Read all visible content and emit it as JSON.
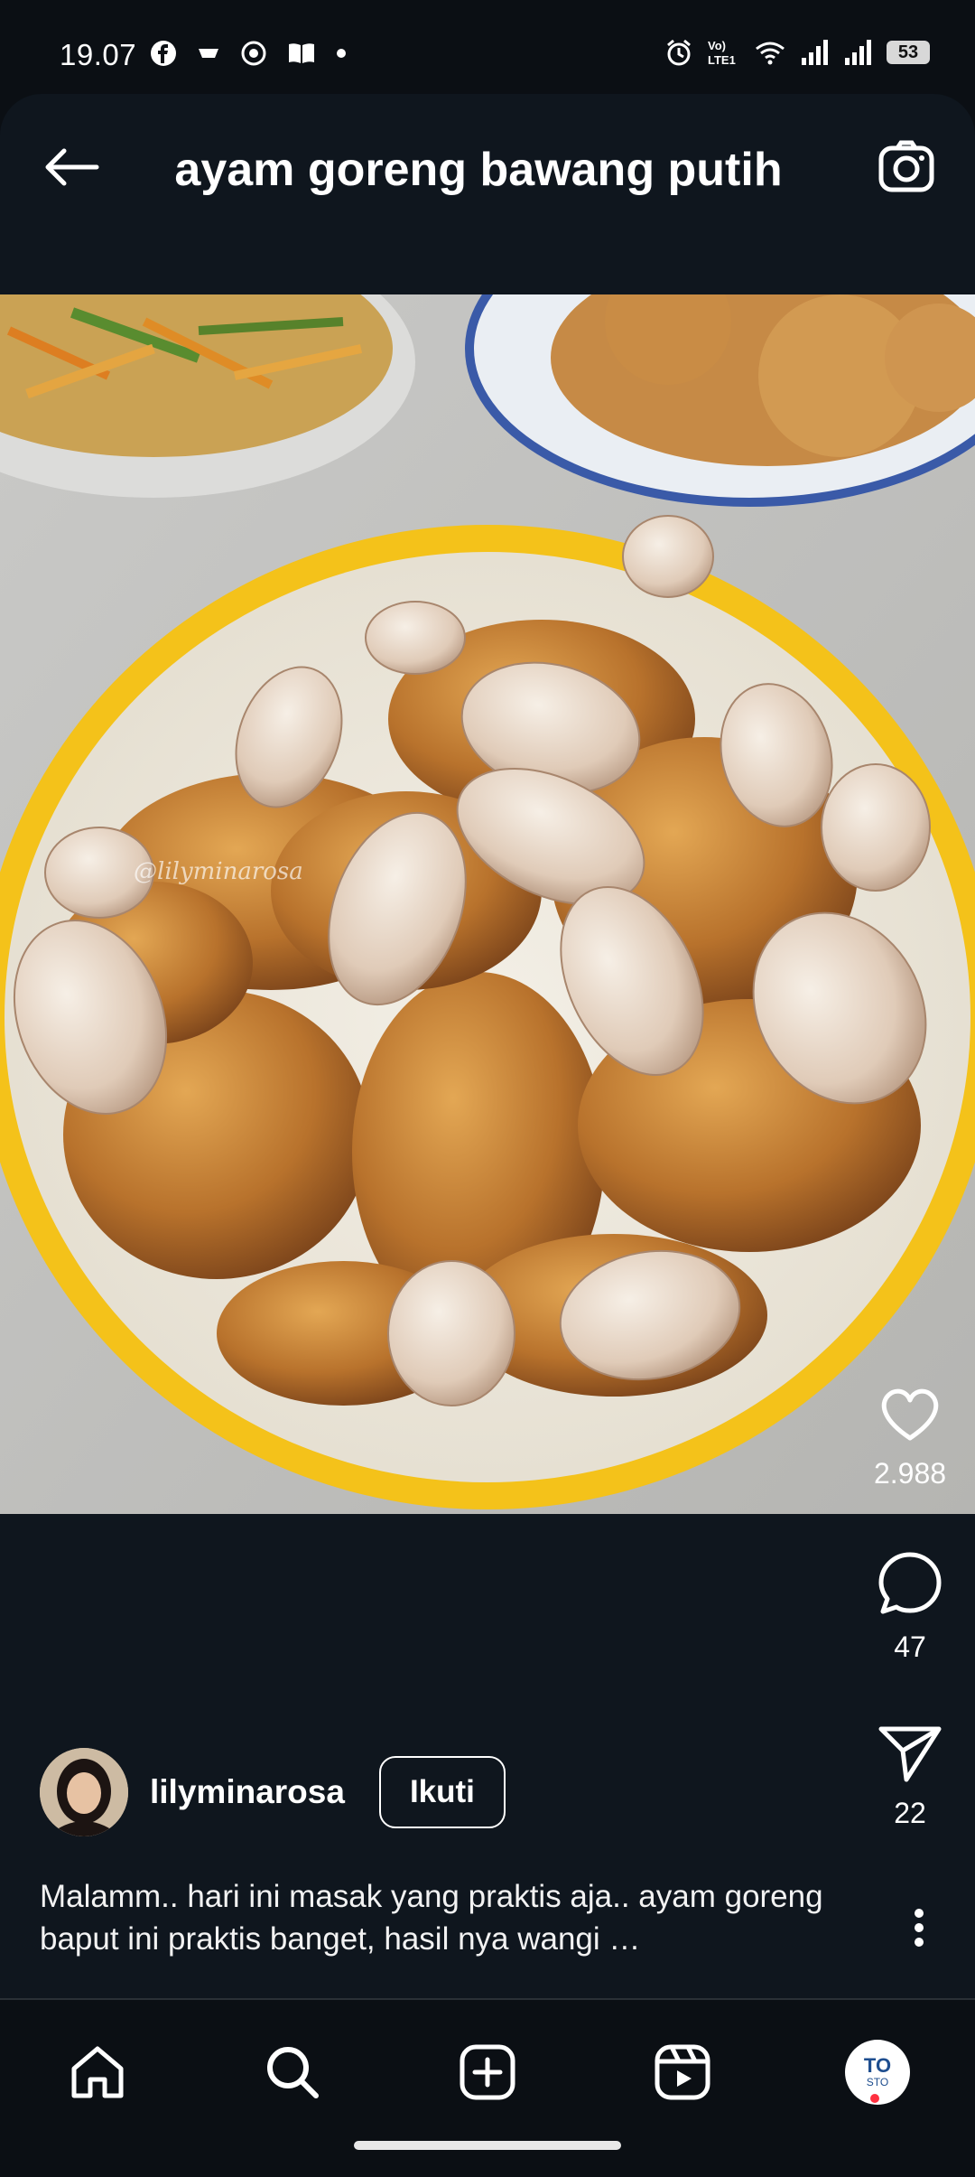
{
  "status": {
    "time": "19.07",
    "battery": "53",
    "left_icons": [
      "facebook-icon",
      "media-icon",
      "target-icon",
      "book-icon",
      "dot-icon"
    ],
    "right_icons": [
      "alarm-icon",
      "volte-icon",
      "wifi-icon",
      "signal-icon",
      "signal-icon"
    ]
  },
  "header": {
    "title": "ayam goreng bawang putih"
  },
  "post": {
    "watermark": "@lilyminarosa",
    "likes": "2.988",
    "comments": "47",
    "shares": "22",
    "author": "lilyminarosa",
    "follow_label": "Ikuti",
    "caption": "Malamm.. hari ini masak yang praktis aja.. ayam goreng baput ini praktis banget, hasil nya wangi …"
  },
  "profile": {
    "avatar_top": "TO",
    "avatar_bottom": "STO"
  },
  "colors": {
    "background": "#0b0f14",
    "notification_dot": "#ff3040",
    "bowl_rim": "#f2c31c"
  }
}
